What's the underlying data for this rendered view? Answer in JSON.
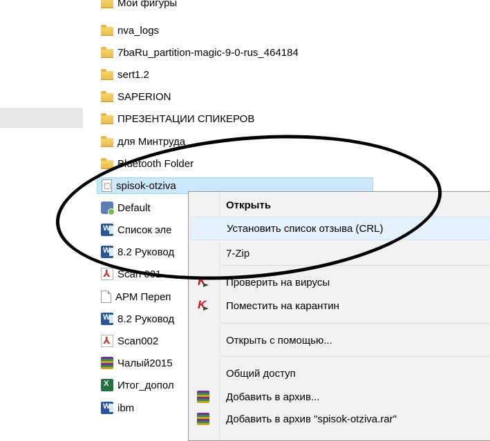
{
  "files": [
    {
      "name": "Мои фигуры",
      "icon": "folder"
    },
    {
      "name": "nva_logs",
      "icon": "folder"
    },
    {
      "name": "7baRu_partition-magic-9-0-rus_464184",
      "icon": "folder"
    },
    {
      "name": "sert1.2",
      "icon": "folder"
    },
    {
      "name": "SAPERION",
      "icon": "folder"
    },
    {
      "name": "ПРЕЗЕНТАЦИИ СПИКЕРОВ",
      "icon": "folder"
    },
    {
      "name": "для Минтруда",
      "icon": "folder"
    },
    {
      "name": "Bluetooth Folder",
      "icon": "folder"
    },
    {
      "name": "spisok-otziva",
      "icon": "crl",
      "selected": true
    },
    {
      "name": "Default",
      "icon": "settings"
    },
    {
      "name": "Список эле",
      "icon": "word"
    },
    {
      "name": "8.2 Руковод",
      "icon": "word"
    },
    {
      "name": "Scan 001",
      "icon": "pdf"
    },
    {
      "name": "АРМ Переп",
      "icon": "doc"
    },
    {
      "name": "8.2 Руковод",
      "icon": "word"
    },
    {
      "name": "Scan002",
      "icon": "pdf"
    },
    {
      "name": "Чалый2015",
      "icon": "rar"
    },
    {
      "name": "Итог_допол",
      "icon": "excel"
    },
    {
      "name": "ibm",
      "icon": "word"
    }
  ],
  "context_menu": {
    "items": [
      {
        "label": "Открыть",
        "bold": true
      },
      {
        "label": "Установить список отзыва (CRL)",
        "hover": true
      },
      {
        "label": "7-Zip"
      },
      {
        "separator": true
      },
      {
        "label": "Проверить на вирусы",
        "icon": "kaspersky"
      },
      {
        "label": "Поместить на карантин",
        "icon": "kaspersky"
      },
      {
        "separator": true
      },
      {
        "label": "Открыть с помощью..."
      },
      {
        "separator": true
      },
      {
        "label": "Общий доступ"
      },
      {
        "label": "Добавить в архив...",
        "icon": "rar"
      },
      {
        "label": "Добавить в архив \"spisok-otziva.rar\"",
        "icon": "rar"
      }
    ]
  },
  "colors": {
    "selection_bg": "#cce8ff",
    "menu_bg": "#f2f2f2",
    "menu_hover": "#e5f1fb",
    "annotation": "#000000"
  }
}
